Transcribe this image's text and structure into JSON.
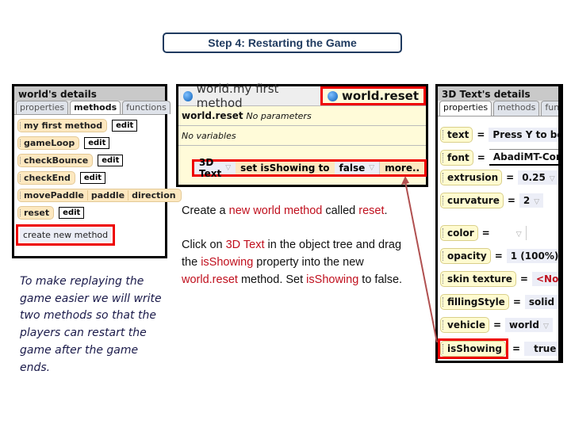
{
  "title": "Step 4: Restarting the Game",
  "left_panel": {
    "header": "world's details",
    "tabs": [
      {
        "label": "properties",
        "active": false
      },
      {
        "label": "methods",
        "active": true
      },
      {
        "label": "functions",
        "active": false
      }
    ],
    "methods": [
      {
        "name": "my first method",
        "action": "edit"
      },
      {
        "name": "gameLoop",
        "action": "edit"
      },
      {
        "name": "checkBounce",
        "action": "edit"
      },
      {
        "name": "checkEnd",
        "action": "edit"
      },
      {
        "name": "movePaddle",
        "params": [
          "paddle",
          "direction"
        ]
      },
      {
        "name": "reset",
        "action": "edit"
      }
    ],
    "create_button": "create new method"
  },
  "left_text": "To make replaying the game easier we will write two methods so that the players can restart the game after the game ends.",
  "editor": {
    "tabs": [
      {
        "label": "world.my first method",
        "active": false
      },
      {
        "label": "world.reset",
        "active": true
      }
    ],
    "method_name": "world.reset",
    "parameters_text": "No parameters",
    "variables_text": "No variables",
    "statement": {
      "object": "3D Text",
      "verb": "set",
      "property": "isShowing",
      "to": "to",
      "value": "false",
      "more": "more.."
    }
  },
  "instructions": {
    "p1": {
      "t1": "Create a ",
      "h1": "new world method",
      "t2": " called ",
      "h2": "reset",
      "t3": "."
    },
    "p2": {
      "t1": "Click on ",
      "h1": "3D Text",
      "t2": " in the object tree and drag the ",
      "h2": "isShowing",
      "t3": " property into the new ",
      "h3": "world.reset",
      "t4": " method. Set ",
      "h4": "isShowing",
      "t5": " to false."
    }
  },
  "right_panel": {
    "header": "3D Text's details",
    "tabs": [
      {
        "label": "properties",
        "active": true
      },
      {
        "label": "methods",
        "active": false
      },
      {
        "label": "fun",
        "active": false
      }
    ],
    "properties": [
      {
        "name": "text",
        "value": "Press Y to begin"
      },
      {
        "name": "font",
        "value": "AbadiMT-Conde"
      },
      {
        "name": "extrusion",
        "value": "0.25"
      },
      {
        "name": "curvature",
        "value": "2"
      },
      {
        "name": "color",
        "value": ""
      },
      {
        "name": "opacity",
        "value": "1 (100%)"
      },
      {
        "name": "skin texture",
        "value": "<None>"
      },
      {
        "name": "fillingStyle",
        "value": "solid"
      },
      {
        "name": "vehicle",
        "value": "world"
      },
      {
        "name": "isShowing",
        "value": "true"
      }
    ],
    "equals": "="
  },
  "dropdown_glyph": "▽",
  "colors": {
    "highlight": "#e00000",
    "accent_text": "#c0101e",
    "title_border": "#1f3a5f",
    "arrow": "#b05050"
  }
}
